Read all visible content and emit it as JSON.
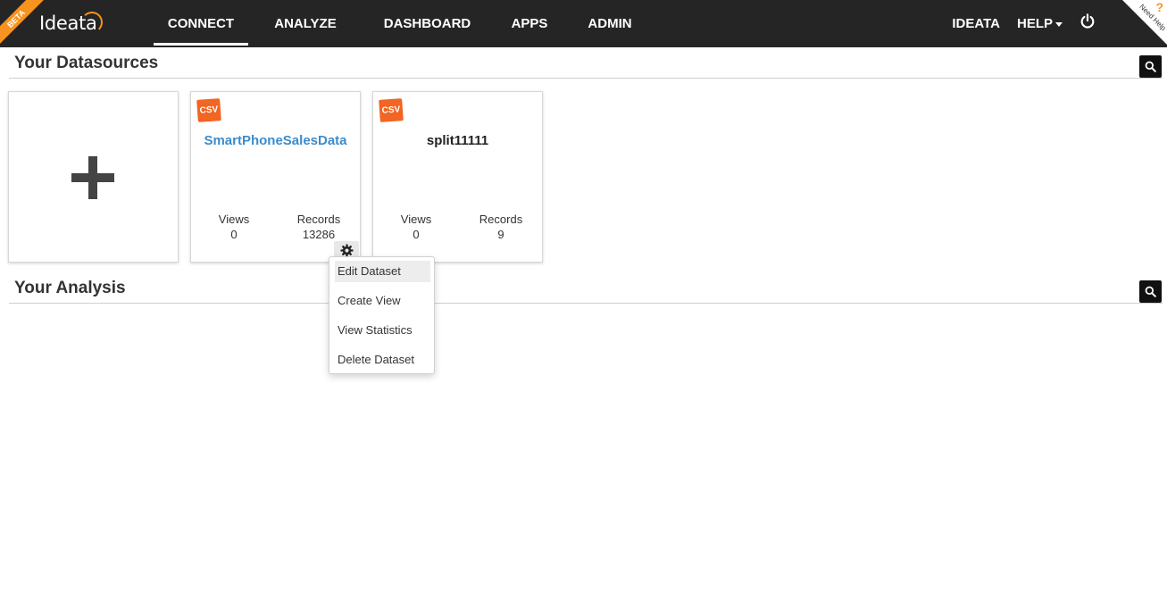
{
  "brand": {
    "logo": "Ideata",
    "badge": "BETA",
    "help_corner": "Need Help",
    "help_corner_icon": "?"
  },
  "nav": {
    "items": [
      {
        "label": "CONNECT",
        "active": true
      },
      {
        "label": "ANALYZE",
        "active": false
      },
      {
        "label": "DASHBOARD",
        "active": false
      },
      {
        "label": "APPS",
        "active": false
      },
      {
        "label": "ADMIN",
        "active": false
      }
    ],
    "user": "IDEATA",
    "help": "HELP"
  },
  "datasources": {
    "title": "Your Datasources",
    "cards": [
      {
        "type": "CSV",
        "name": "SmartPhoneSalesData",
        "views_label": "Views",
        "views": "0",
        "records_label": "Records",
        "records": "13286"
      },
      {
        "type": "CSV",
        "name": "split11111",
        "views_label": "Views",
        "views": "0",
        "records_label": "Records",
        "records": "9"
      }
    ]
  },
  "analysis": {
    "title": "Your Analysis"
  },
  "context_menu": {
    "items": [
      "Edit Dataset",
      "Create View",
      "View Statistics",
      "Delete Dataset"
    ],
    "highlighted": "Edit Dataset"
  },
  "colors": {
    "topbar": "#252525",
    "accent": "#f7931e",
    "link": "#3b8ccc",
    "csv": "#f26522"
  }
}
